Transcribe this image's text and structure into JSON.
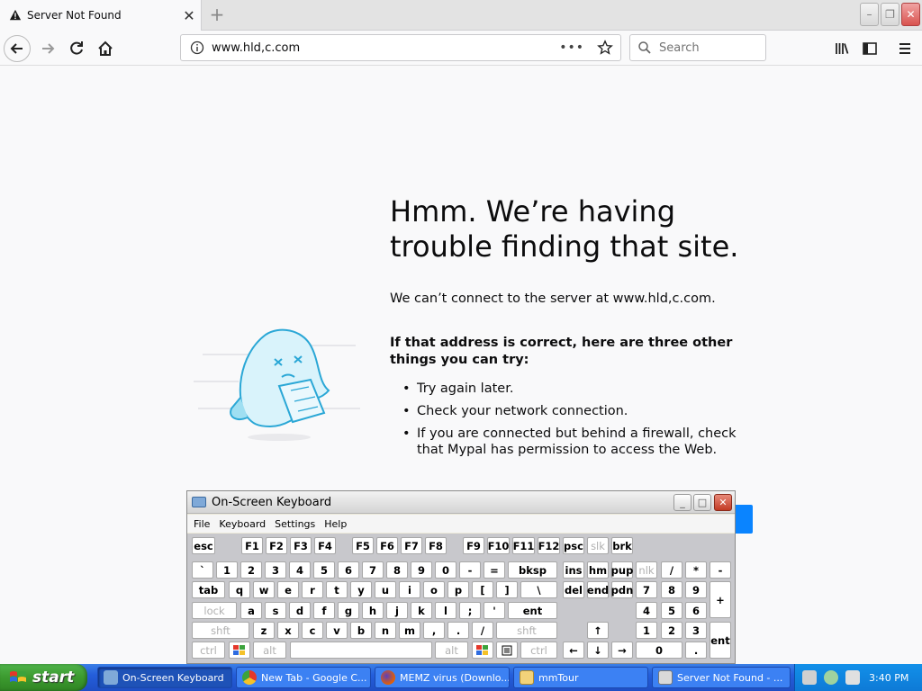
{
  "browser": {
    "tab": {
      "title": "Server Not Found"
    },
    "url": "www.hld,c.com",
    "search_placeholder": "Search"
  },
  "error_page": {
    "title": "Hmm. We’re having trouble finding that site.",
    "description": "We can’t connect to the server at www.hld,c.com.",
    "subheading": "If that address is correct, here are three other things you can try:",
    "suggestions": [
      "Try again later.",
      "Check your network connection.",
      "If you are connected but behind a firewall, check that Mypal has permission to access the Web."
    ]
  },
  "osk": {
    "title": "On-Screen Keyboard",
    "menu": [
      "File",
      "Keyboard",
      "Settings",
      "Help"
    ],
    "rows": {
      "fn": [
        "esc",
        "F1",
        "F2",
        "F3",
        "F4",
        "F5",
        "F6",
        "F7",
        "F8",
        "F9",
        "F10",
        "F11",
        "F12",
        "psc",
        "slk",
        "brk"
      ],
      "num": [
        "`",
        "1",
        "2",
        "3",
        "4",
        "5",
        "6",
        "7",
        "8",
        "9",
        "0",
        "-",
        "=",
        "bksp",
        "ins",
        "hm",
        "pup",
        "nlk",
        "/",
        "*",
        "-"
      ],
      "top": [
        "tab",
        "q",
        "w",
        "e",
        "r",
        "t",
        "y",
        "u",
        "i",
        "o",
        "p",
        "[",
        "]",
        "\\",
        "del",
        "end",
        "pdn",
        "7",
        "8",
        "9",
        "+"
      ],
      "home": [
        "lock",
        "a",
        "s",
        "d",
        "f",
        "g",
        "h",
        "j",
        "k",
        "l",
        ";",
        "'",
        "ent",
        "4",
        "5",
        "6"
      ],
      "shift": [
        "shft",
        "z",
        "x",
        "c",
        "v",
        "b",
        "n",
        "m",
        ",",
        ".",
        "/",
        "shft",
        "↑",
        "1",
        "2",
        "3",
        "ent"
      ],
      "bottom": [
        "ctrl",
        "alt",
        "alt",
        "ctrl",
        "←",
        "↓",
        "→",
        "0",
        "."
      ]
    }
  },
  "taskbar": {
    "start_label": "start",
    "items": [
      "On-Screen Keyboard",
      "New Tab - Google C...",
      "MEMZ virus (Downlo...",
      "mmTour",
      "Server Not Found - ..."
    ],
    "clock": "3:40 PM"
  },
  "colors": {
    "accent": "#0a84ff",
    "taskbar_blue": "#245edb",
    "start_green": "#3c9a2f"
  }
}
